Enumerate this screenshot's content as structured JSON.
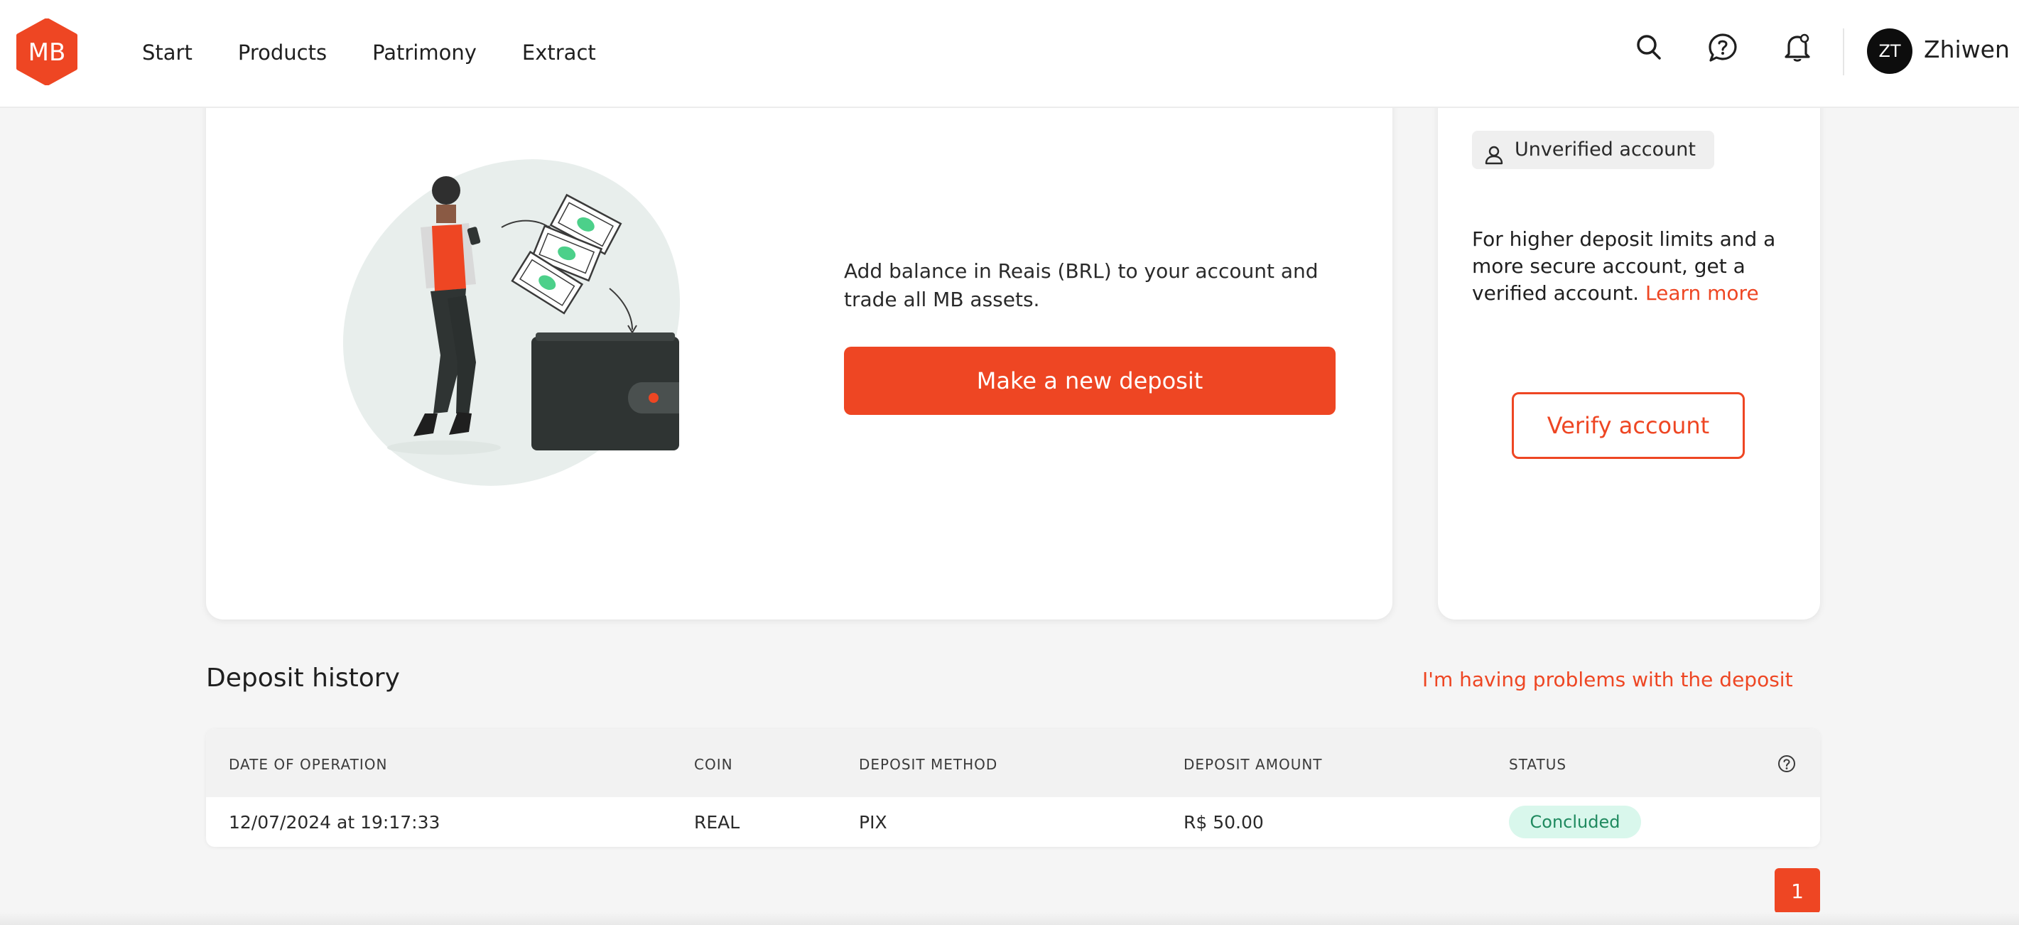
{
  "header": {
    "logo_text": "MB",
    "nav": [
      "Start",
      "Products",
      "Patrimony",
      "Extract"
    ],
    "icons": [
      "search-icon",
      "help-icon",
      "bell-icon"
    ],
    "avatar_initials": "ZT",
    "username": "Zhiwen"
  },
  "deposit_card": {
    "description": "Add balance in Reais (BRL) to your account and trade all MB assets.",
    "button_label": "Make a new deposit"
  },
  "verify_card": {
    "badge_label": "Unverified account",
    "text": "For higher deposit limits and a more secure account, get a verified account.",
    "learn_more": "Learn more",
    "button_label": "Verify account"
  },
  "history": {
    "title": "Deposit history",
    "problem_link": "I'm having problems with the deposit",
    "columns": [
      "DATE OF OPERATION",
      "COIN",
      "DEPOSIT METHOD",
      "DEPOSIT AMOUNT",
      "STATUS"
    ],
    "rows": [
      {
        "date": "12/07/2024 at 19:17:33",
        "coin": "REAL",
        "method": "PIX",
        "amount": "R$ 50.00",
        "status": "Concluded"
      }
    ]
  },
  "pagination": {
    "current": "1"
  },
  "colors": {
    "accent": "#ee4623",
    "success_bg": "#d9f7ec",
    "success_text": "#1f8a5f"
  }
}
